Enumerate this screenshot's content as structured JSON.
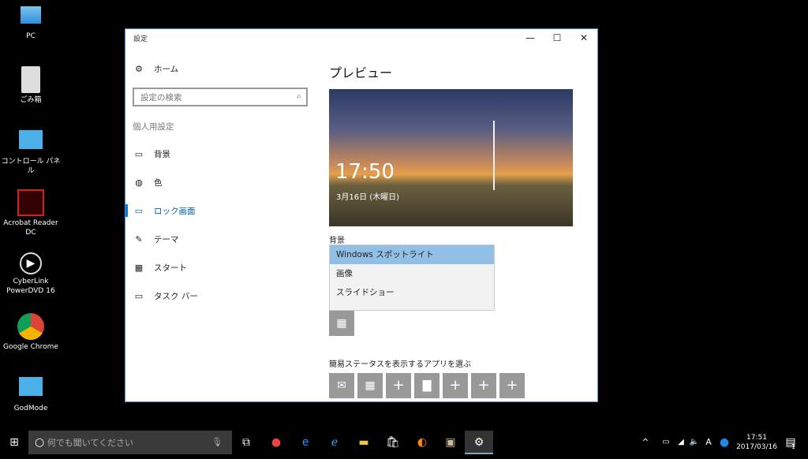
{
  "desktop": {
    "icons": [
      {
        "label": "PC"
      },
      {
        "label": "ごみ箱"
      },
      {
        "label": "コントロール パネル"
      },
      {
        "label": "Acrobat Reader DC"
      },
      {
        "label": "CyberLink PowerDVD 16"
      },
      {
        "label": "Google Chrome"
      },
      {
        "label": "GodMode"
      }
    ]
  },
  "window": {
    "title": "設定",
    "minimize": "—",
    "maximize": "☐",
    "close": "✕"
  },
  "sidebar": {
    "home": "ホーム",
    "search_placeholder": "設定の検索",
    "section": "個人用設定",
    "items": [
      {
        "label": "背景",
        "icon": "image-icon"
      },
      {
        "label": "色",
        "icon": "palette-icon"
      },
      {
        "label": "ロック画面",
        "icon": "lock-screen-icon",
        "active": true
      },
      {
        "label": "テーマ",
        "icon": "theme-icon"
      },
      {
        "label": "スタート",
        "icon": "start-icon"
      },
      {
        "label": "タスク バー",
        "icon": "taskbar-icon"
      }
    ]
  },
  "main": {
    "title": "プレビュー",
    "preview_time": "17:50",
    "preview_date": "3月16日 (木曜日)",
    "background_label": "背景",
    "dropdown_options": [
      "Windows スポットライト",
      "画像",
      "スライドショー"
    ],
    "selected": "Windows スポットライト",
    "quick_status_label": "簡易ステータスを表示するアプリを選ぶ",
    "quick_tiles": [
      "mail-icon",
      "calendar-icon",
      "+",
      "message-icon",
      "+",
      "+",
      "+"
    ]
  },
  "taskbar": {
    "search_placeholder": "何でも聞いてください",
    "time": "17:51",
    "date": "2017/03/16",
    "notification_count": "1",
    "ime": "A"
  },
  "colors": {
    "accent": "#0078d7",
    "selected": "#91bfe6",
    "tile": "#999999"
  }
}
